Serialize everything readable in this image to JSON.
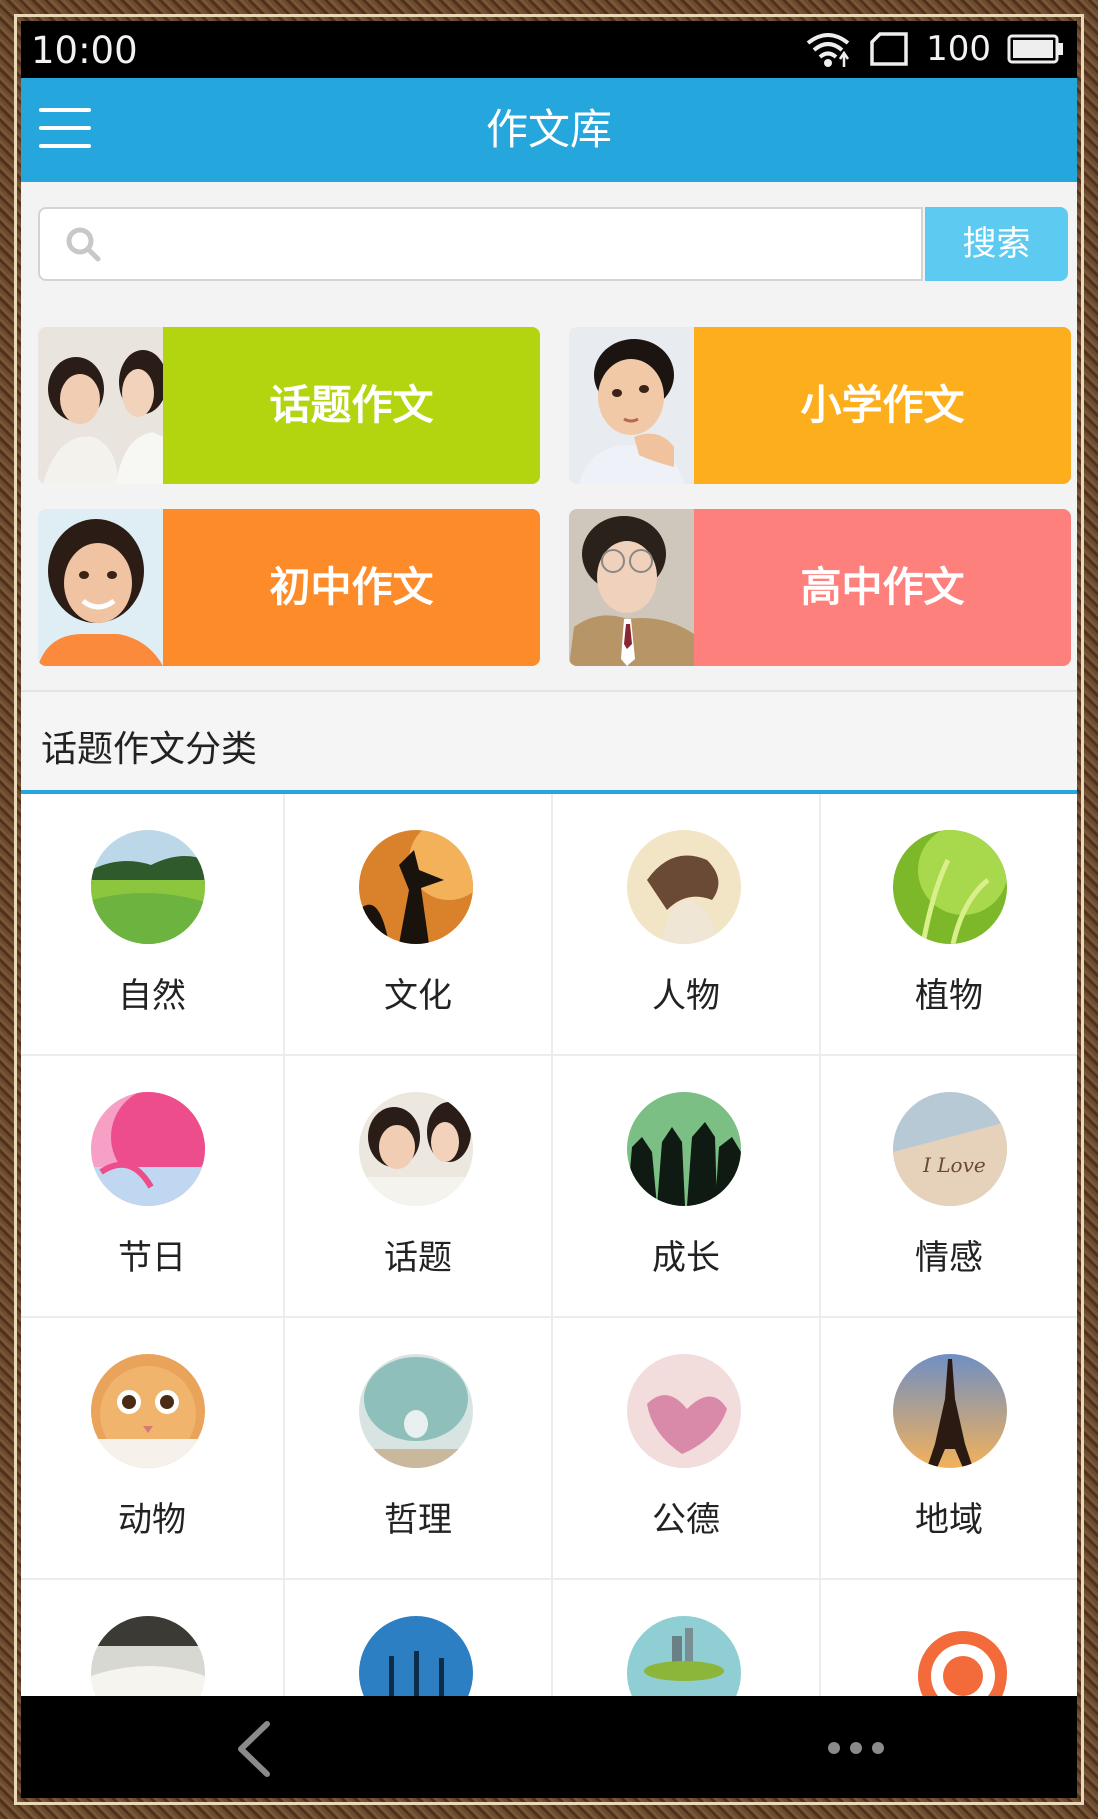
{
  "status_bar": {
    "time": "10:00",
    "battery": "100",
    "icons": [
      "wifi-icon",
      "sim-card-icon",
      "battery-icon"
    ]
  },
  "app_bar": {
    "title": "作文库",
    "menu_icon": "menu-icon"
  },
  "search": {
    "placeholder": "",
    "value": "",
    "button_label": "搜索",
    "accent": "#5ccaf1"
  },
  "categories": [
    {
      "label": "话题作文",
      "color": "#b2d510"
    },
    {
      "label": "小学作文",
      "color": "#fdae1c"
    },
    {
      "label": "初中作文",
      "color": "#fd8b2a"
    },
    {
      "label": "高中作文",
      "color": "#fd807d"
    }
  ],
  "section": {
    "title": "话题作文分类"
  },
  "topics": [
    {
      "label": "自然"
    },
    {
      "label": "文化"
    },
    {
      "label": "人物"
    },
    {
      "label": "植物"
    },
    {
      "label": "节日"
    },
    {
      "label": "话题"
    },
    {
      "label": "成长"
    },
    {
      "label": "情感"
    },
    {
      "label": "动物"
    },
    {
      "label": "哲理"
    },
    {
      "label": "公德"
    },
    {
      "label": "地域"
    }
  ],
  "colors": {
    "app_bar": "#25a6dc",
    "section_underline": "#25a6dc"
  },
  "bottom_nav": {
    "icons": [
      "back-icon",
      "more-icon"
    ]
  }
}
